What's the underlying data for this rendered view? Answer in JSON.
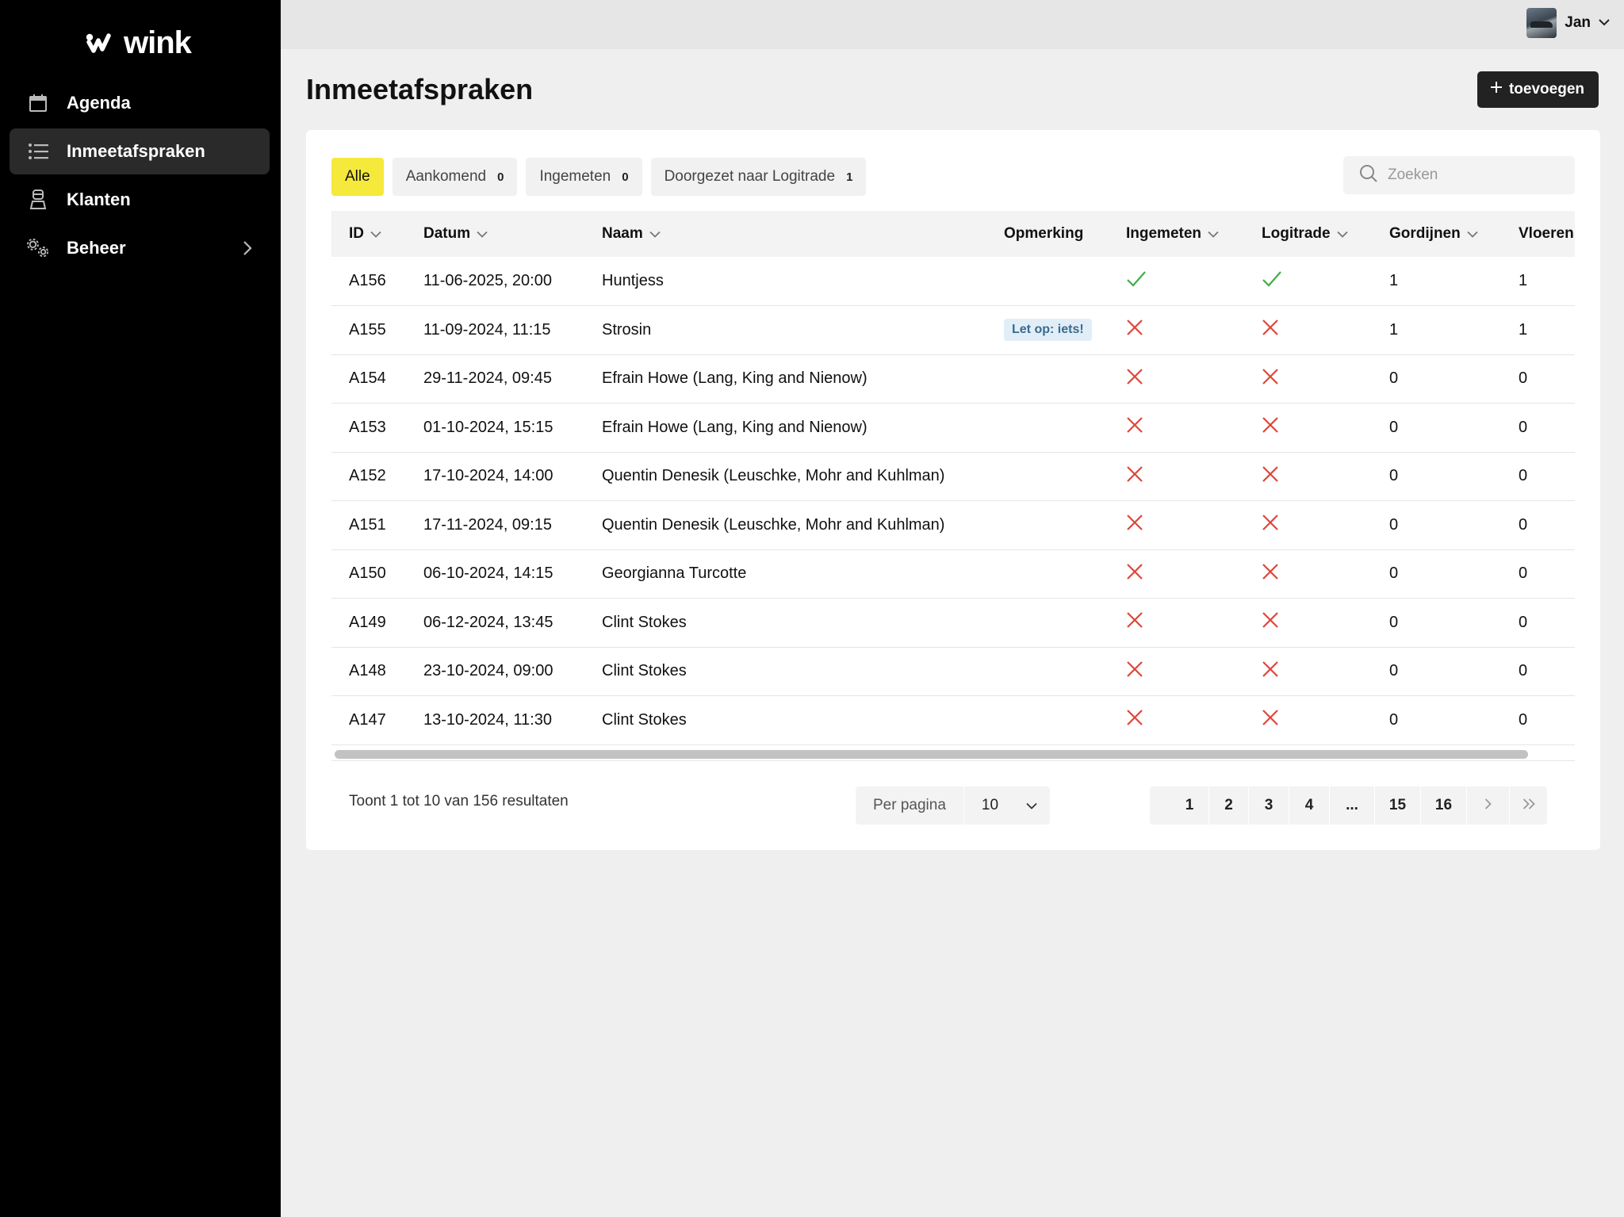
{
  "app": {
    "logo_text": "wink"
  },
  "sidebar": {
    "items": [
      {
        "label": "Agenda",
        "icon": "calendar-icon",
        "active": false
      },
      {
        "label": "Inmeetafspraken",
        "icon": "list-icon",
        "active": true
      },
      {
        "label": "Klanten",
        "icon": "person-icon",
        "active": false
      },
      {
        "label": "Beheer",
        "icon": "gears-icon",
        "active": false,
        "has_submenu": true
      }
    ]
  },
  "topbar": {
    "user_name": "Jan"
  },
  "header": {
    "title": "Inmeetafspraken",
    "add_button": "toevoegen"
  },
  "filters": {
    "tabs": [
      {
        "label": "Alle",
        "count": null,
        "active": true
      },
      {
        "label": "Aankomend",
        "count": "0",
        "active": false
      },
      {
        "label": "Ingemeten",
        "count": "0",
        "active": false
      },
      {
        "label": "Doorgezet naar Logitrade",
        "count": "1",
        "active": false
      }
    ],
    "search_placeholder": "Zoeken"
  },
  "table": {
    "columns": [
      "ID",
      "Datum",
      "Naam",
      "Opmerking",
      "Ingemeten",
      "Logitrade",
      "Gordijnen",
      "Vloeren"
    ],
    "rows": [
      {
        "id": "A156",
        "datum": "11-06-2025, 20:00",
        "naam": "Huntjess",
        "opmerking": "",
        "ingemeten": true,
        "logitrade": true,
        "gordijnen": "1",
        "vloeren": "1"
      },
      {
        "id": "A155",
        "datum": "11-09-2024, 11:15",
        "naam": "Strosin",
        "opmerking": "Let op: iets!",
        "ingemeten": false,
        "logitrade": false,
        "gordijnen": "1",
        "vloeren": "1"
      },
      {
        "id": "A154",
        "datum": "29-11-2024, 09:45",
        "naam": "Efrain Howe (Lang, King and Nienow)",
        "opmerking": "",
        "ingemeten": false,
        "logitrade": false,
        "gordijnen": "0",
        "vloeren": "0"
      },
      {
        "id": "A153",
        "datum": "01-10-2024, 15:15",
        "naam": "Efrain Howe (Lang, King and Nienow)",
        "opmerking": "",
        "ingemeten": false,
        "logitrade": false,
        "gordijnen": "0",
        "vloeren": "0"
      },
      {
        "id": "A152",
        "datum": "17-10-2024, 14:00",
        "naam": "Quentin Denesik (Leuschke, Mohr and Kuhlman)",
        "opmerking": "",
        "ingemeten": false,
        "logitrade": false,
        "gordijnen": "0",
        "vloeren": "0"
      },
      {
        "id": "A151",
        "datum": "17-11-2024, 09:15",
        "naam": "Quentin Denesik (Leuschke, Mohr and Kuhlman)",
        "opmerking": "",
        "ingemeten": false,
        "logitrade": false,
        "gordijnen": "0",
        "vloeren": "0"
      },
      {
        "id": "A150",
        "datum": "06-10-2024, 14:15",
        "naam": "Georgianna Turcotte",
        "opmerking": "",
        "ingemeten": false,
        "logitrade": false,
        "gordijnen": "0",
        "vloeren": "0"
      },
      {
        "id": "A149",
        "datum": "06-12-2024, 13:45",
        "naam": "Clint Stokes",
        "opmerking": "",
        "ingemeten": false,
        "logitrade": false,
        "gordijnen": "0",
        "vloeren": "0"
      },
      {
        "id": "A148",
        "datum": "23-10-2024, 09:00",
        "naam": "Clint Stokes",
        "opmerking": "",
        "ingemeten": false,
        "logitrade": false,
        "gordijnen": "0",
        "vloeren": "0"
      },
      {
        "id": "A147",
        "datum": "13-10-2024, 11:30",
        "naam": "Clint Stokes",
        "opmerking": "",
        "ingemeten": false,
        "logitrade": false,
        "gordijnen": "0",
        "vloeren": "0"
      }
    ]
  },
  "footer": {
    "result_text": "Toont 1 tot 10 van 156 resultaten",
    "per_page_label": "Per pagina",
    "per_page_value": "10",
    "pages": [
      "1",
      "2",
      "3",
      "4",
      "...",
      "15",
      "16"
    ],
    "current_page": "1"
  },
  "colors": {
    "accent_yellow": "#f5e93b",
    "check_green": "#3fae49",
    "cross_red": "#e0453a",
    "sidebar_bg": "#000000"
  }
}
